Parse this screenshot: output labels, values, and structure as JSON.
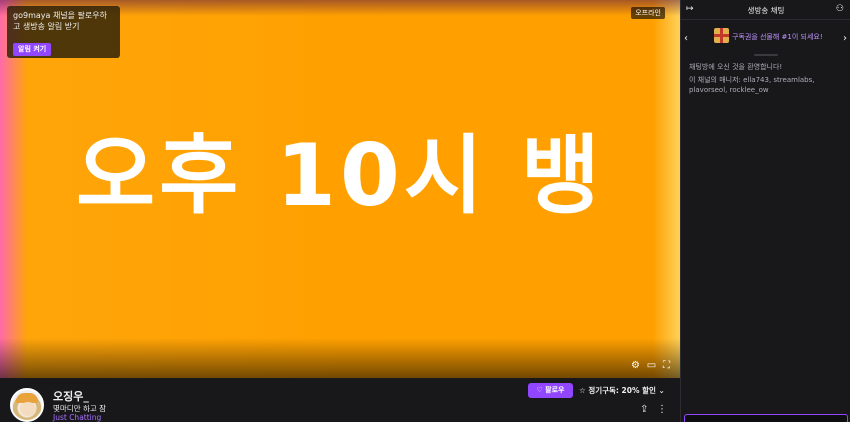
{
  "player": {
    "headline": "오후 10시 뱅",
    "offline_badge": "오프라인",
    "follow_card": {
      "message": "go9maya 채널을 팔로우하고 생방송 알림 받기",
      "button": "알림 켜기"
    },
    "controls": {
      "settings_icon": "⚙",
      "theatre_icon": "▭",
      "fullscreen_icon": "⛶"
    }
  },
  "channel": {
    "name": "오징우_",
    "title": "몇마디만 하고 잠",
    "category": "Just Chatting",
    "follow_label": "♡ 팔로우",
    "subscribe_label": "☆ 정기구독: 20% 할인 ⌄",
    "share_icon": "⇪",
    "more_icon": "⋮"
  },
  "chat": {
    "collapse_icon": "↦",
    "title": "생방송 채팅",
    "users_icon": "⚇",
    "gift_banner": {
      "prev_icon": "‹",
      "next_icon": "›",
      "text": "구독권을 선물해 #1이 되세요!"
    },
    "welcome": "채팅방에 오신 것을 환영합니다!",
    "mods": "이 채널의 매니저: ella743, streamlabs, plavorseol, rocklee_ow"
  },
  "colors": {
    "accent": "#9147ff",
    "player_bg": "#ffa000",
    "panel_bg": "#18181b"
  }
}
